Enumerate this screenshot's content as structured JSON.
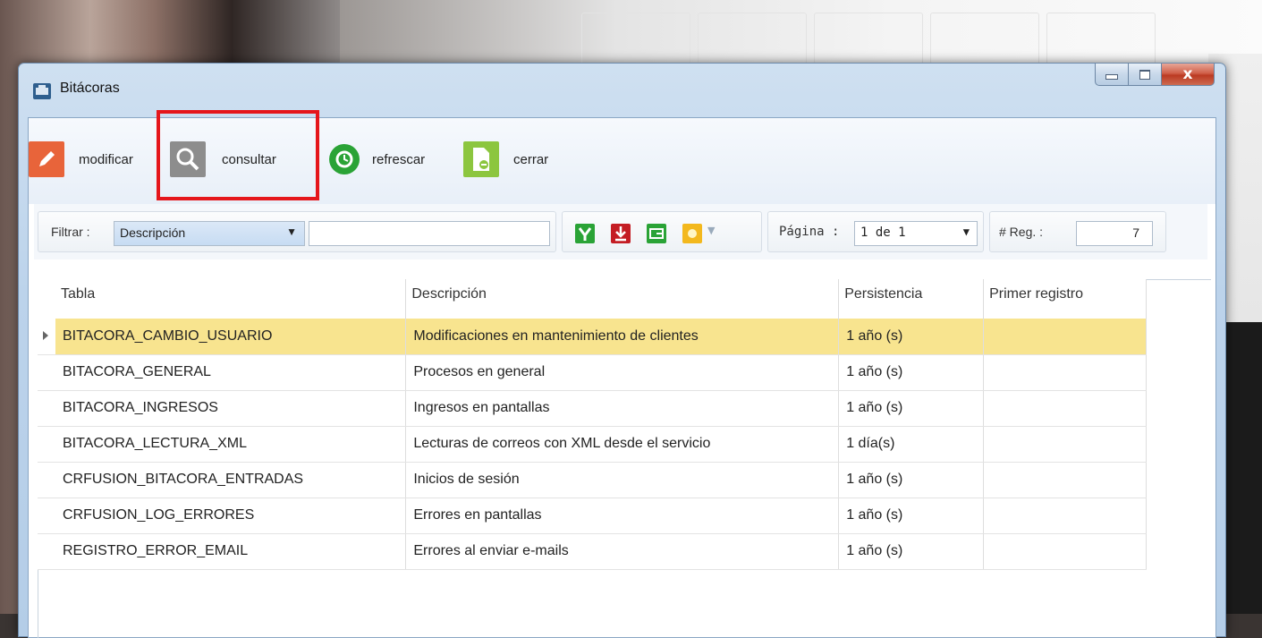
{
  "window": {
    "title": "Bitácoras",
    "close_glyph": "x"
  },
  "toolbar": {
    "modify": "modificar",
    "query": "consultar",
    "refresh": "refrescar",
    "close": "cerrar"
  },
  "filter": {
    "label": "Filtrar :",
    "field": "Descripción",
    "text": "",
    "page_label": "Página :",
    "page_value": "1 de 1",
    "reg_label": "# Reg. :",
    "reg_value": "7"
  },
  "grid": {
    "columns": [
      "Tabla",
      "Descripción",
      "Persistencia",
      "Primer registro"
    ],
    "rows": [
      [
        "BITACORA_CAMBIO_USUARIO",
        "Modificaciones en mantenimiento de clientes",
        "1 año (s)",
        ""
      ],
      [
        "BITACORA_GENERAL",
        "Procesos en general",
        "1 año (s)",
        ""
      ],
      [
        "BITACORA_INGRESOS",
        "Ingresos en pantallas",
        "1 año (s)",
        ""
      ],
      [
        "BITACORA_LECTURA_XML",
        "Lecturas de correos con XML desde el servicio",
        "1 día(s)",
        ""
      ],
      [
        "CRFUSION_BITACORA_ENTRADAS",
        "Inicios de sesión",
        "1 año (s)",
        ""
      ],
      [
        "CRFUSION_LOG_ERRORES",
        "Errores en pantallas",
        "1 año (s)",
        ""
      ],
      [
        "REGISTRO_ERROR_EMAIL",
        "Errores al enviar e-mails",
        "1 año (s)",
        ""
      ]
    ]
  },
  "colors": {
    "selected_row": "#f8e48f",
    "highlight_box": "#e5161b"
  }
}
